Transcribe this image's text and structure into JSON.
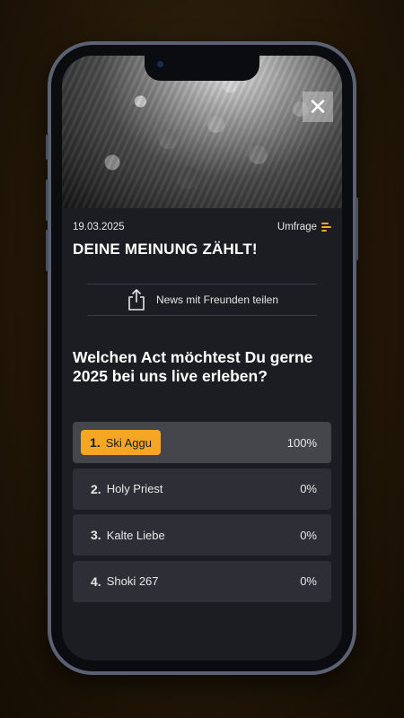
{
  "hero": {
    "close_label": "✕"
  },
  "meta": {
    "date": "19.03.2025",
    "category": "Umfrage"
  },
  "page_title": "DEINE MEINUNG ZÄHLT!",
  "share": {
    "label": "News mit Freunden teilen"
  },
  "poll": {
    "question": "Welchen Act möchtest Du gerne 2025 bei uns live erleben?",
    "options": [
      {
        "num": "1.",
        "label": "Ski Aggu",
        "percent": "100%",
        "selected": true
      },
      {
        "num": "2.",
        "label": "Holy Priest",
        "percent": "0%",
        "selected": false
      },
      {
        "num": "3.",
        "label": "Kalte Liebe",
        "percent": "0%",
        "selected": false
      },
      {
        "num": "4.",
        "label": "Shoki 267",
        "percent": "0%",
        "selected": false
      }
    ]
  },
  "colors": {
    "accent": "#f5a623",
    "background": "#1c1d22",
    "option_bg": "#2e2f36"
  }
}
